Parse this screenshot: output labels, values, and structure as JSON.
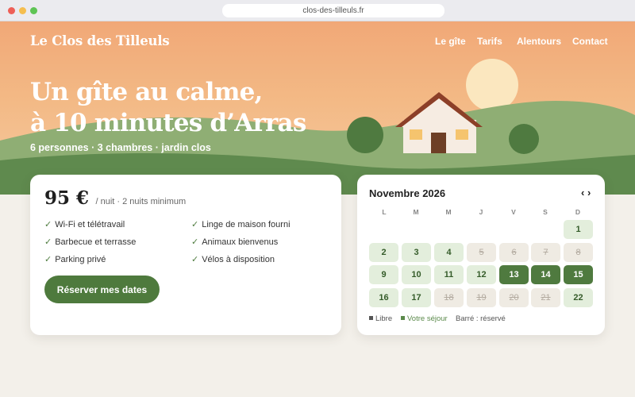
{
  "browser": {
    "url": "clos-des-tilleuls.fr"
  },
  "site": {
    "logo": "Le Clos des Tilleuls"
  },
  "nav": {
    "items": [
      "Le gîte",
      "Tarifs",
      "Alentours",
      "Contact"
    ]
  },
  "hero": {
    "headline_line1": "Un gîte au calme,",
    "headline_line2": "à 10 minutes d’Arras",
    "subline": "6 personnes · 3 chambres · jardin clos"
  },
  "pricing": {
    "price": "95 €",
    "note": "/ nuit · 2 nuits minimum",
    "features": [
      "Wi-Fi et télétravail",
      "Linge de maison fourni",
      "Barbecue et terrasse",
      "Animaux bienvenus",
      "Parking privé",
      "Vélos à disposition"
    ],
    "check_glyph": "✓",
    "cta": "Réserver mes dates"
  },
  "calendar": {
    "month": "Novembre 2026",
    "prev": "‹",
    "next": "›",
    "weekdays": [
      "L",
      "M",
      "M",
      "J",
      "V",
      "S",
      "D"
    ],
    "days": [
      {
        "n": "1",
        "state": "free"
      },
      {
        "n": "2",
        "state": "free"
      },
      {
        "n": "3",
        "state": "free"
      },
      {
        "n": "4",
        "state": "free"
      },
      {
        "n": "5",
        "state": "booked"
      },
      {
        "n": "6",
        "state": "booked"
      },
      {
        "n": "7",
        "state": "booked"
      },
      {
        "n": "8",
        "state": "booked"
      },
      {
        "n": "9",
        "state": "free"
      },
      {
        "n": "10",
        "state": "free"
      },
      {
        "n": "11",
        "state": "free"
      },
      {
        "n": "12",
        "state": "free"
      },
      {
        "n": "13",
        "state": "selected"
      },
      {
        "n": "14",
        "state": "selected"
      },
      {
        "n": "15",
        "state": "selected"
      },
      {
        "n": "16",
        "state": "free"
      },
      {
        "n": "17",
        "state": "free"
      },
      {
        "n": "18",
        "state": "booked"
      },
      {
        "n": "19",
        "state": "booked"
      },
      {
        "n": "20",
        "state": "booked"
      },
      {
        "n": "21",
        "state": "booked"
      },
      {
        "n": "22",
        "state": "free"
      }
    ],
    "legend": {
      "libre": "Libre",
      "sejour": "Votre séjour",
      "reserve": "Barré : réservé"
    }
  },
  "colors": {
    "accent_green": "#4e7a3d",
    "hero_peach": "#f3b985",
    "free_day": "#e3eedc",
    "booked_day": "#efebe3"
  },
  "icons": {
    "legend_marker": "small-square"
  }
}
